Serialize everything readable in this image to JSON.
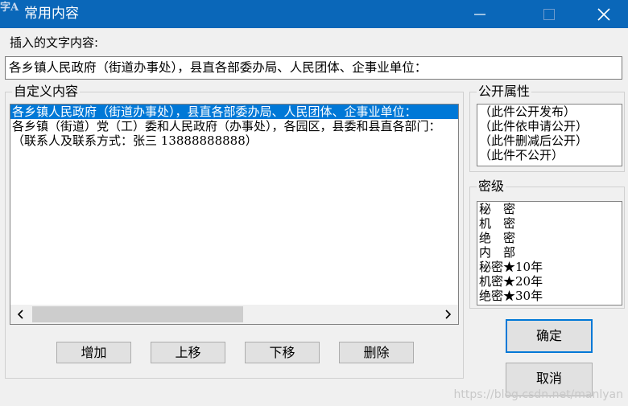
{
  "window": {
    "title": "常用内容",
    "icon_text": "字A",
    "icon": "app-text-icon"
  },
  "insert": {
    "label": "插入的文字内容:",
    "value": "各乡镇人民政府（街道办事处），县直各部委办局、人民团体、企事业单位："
  },
  "custom": {
    "legend": "自定义内容",
    "items": [
      "各乡镇人民政府（街道办事处），县直各部委办局、人民团体、企事业单位：",
      "各乡镇（街道）党（工）委和人民政府（办事处），各园区，县委和县直各部门：",
      "（联系人及联系方式：张三 13888888888）"
    ],
    "selected_index": 0,
    "scrollbar": {
      "thumb_fraction": 0.48
    }
  },
  "buttons": {
    "add": "增加",
    "up": "上移",
    "down": "下移",
    "delete": "删除",
    "ok": "确定",
    "cancel": "取消"
  },
  "public": {
    "legend": "公开属性",
    "items": [
      "（此件公开发布）",
      "（此件依申请公开）",
      "（此件删减后公开）",
      "（此件不公开）"
    ]
  },
  "secret": {
    "legend": "密级",
    "items": [
      "秘　密",
      "机　密",
      "绝　密",
      "内　部",
      "秘密★10年",
      "机密★20年",
      "绝密★30年"
    ]
  },
  "watermark": "https://blog.csdn.net/manlyan",
  "colors": {
    "titlebar": "#0a67b9",
    "selection": "#0078d7",
    "window_bg": "#f0f0f0"
  }
}
